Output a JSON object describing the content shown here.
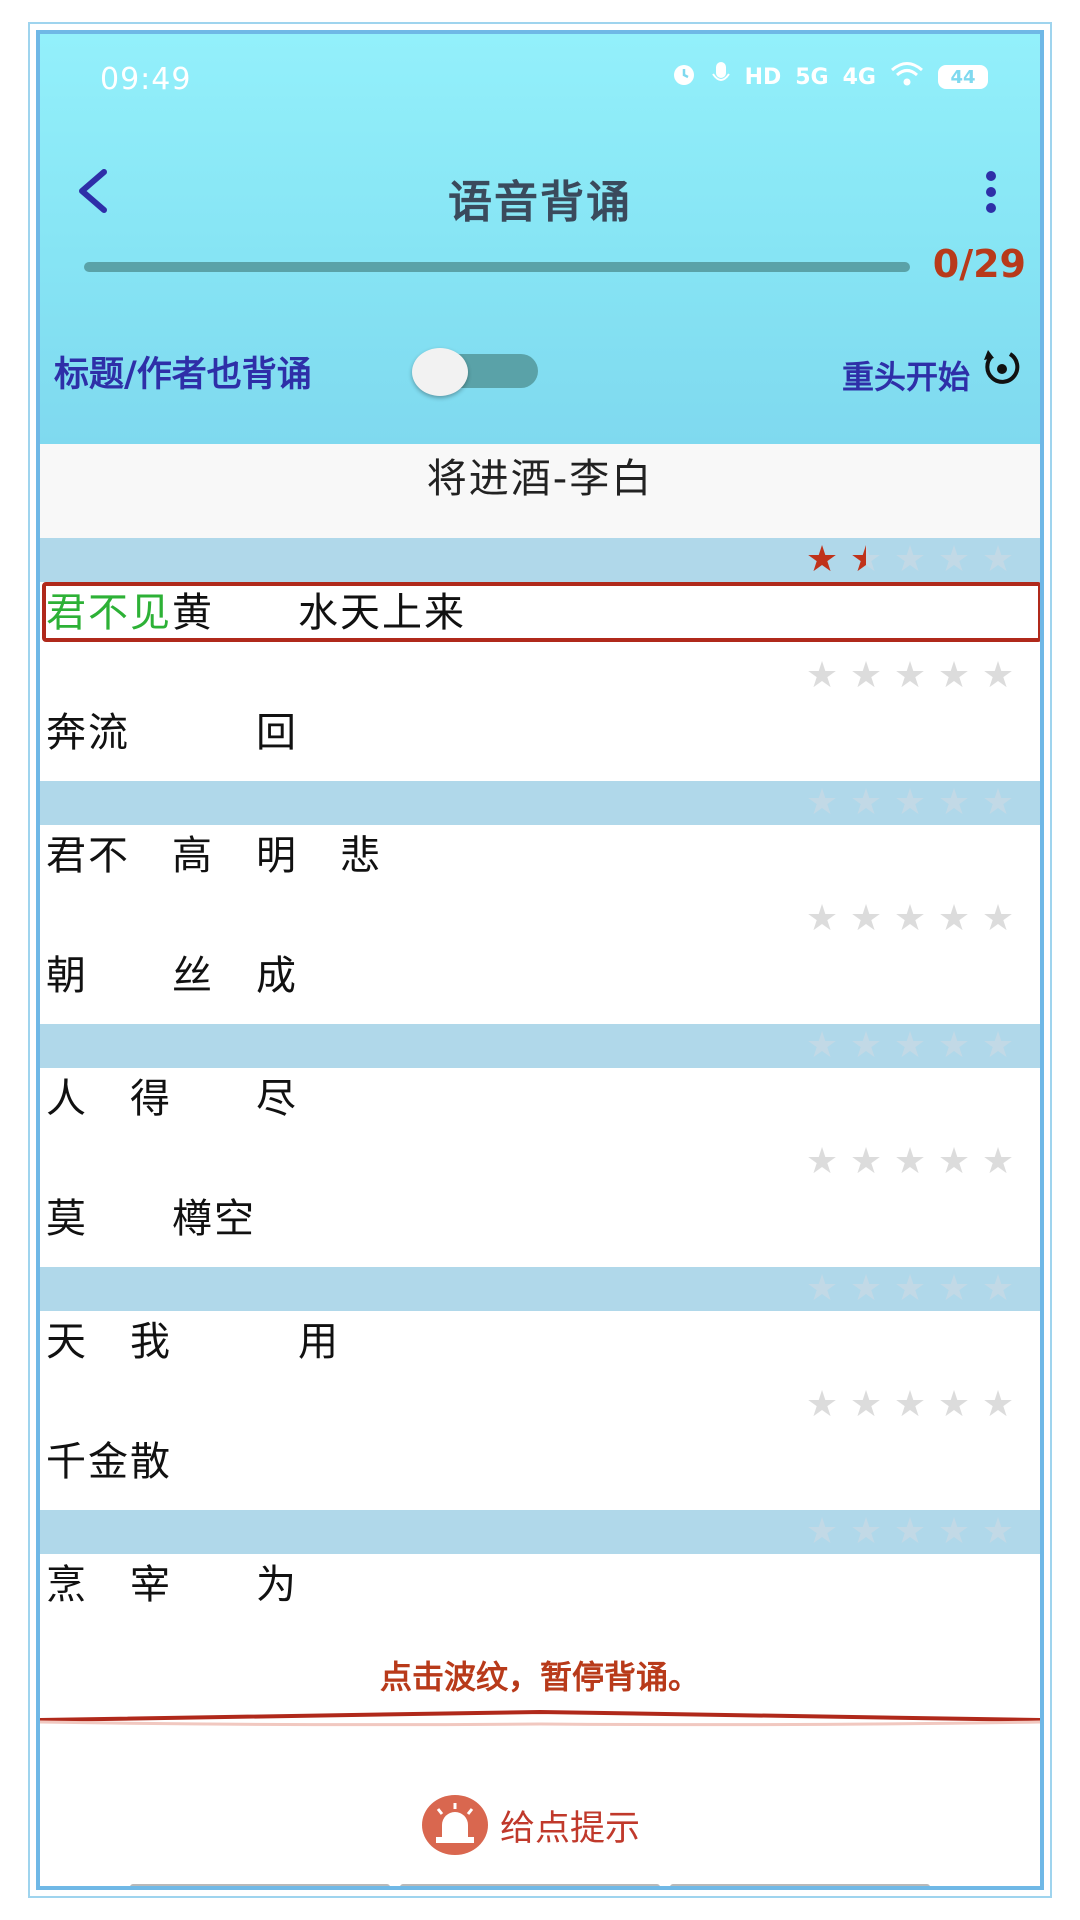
{
  "status_bar": {
    "time": "09:49",
    "hd_label": "HD",
    "net_5g": "5G",
    "net_4g": "4G",
    "battery": "44"
  },
  "header": {
    "title": "语音背诵"
  },
  "progress": {
    "text": "0/29",
    "fraction": 0.0
  },
  "controls": {
    "toggle_label": "标题/作者也背诵",
    "toggle_on": false,
    "restart_label": "重头开始"
  },
  "poem_title": "将进酒-李白",
  "couplets": [
    {
      "rating": 1.5,
      "line_a_pre": "君不见",
      "line_a": "黄　　水天上来",
      "line_b_rating": 0,
      "line_b": "奔流　　　回"
    },
    {
      "rating": 0,
      "line_a_pre": "",
      "line_a": "君不　高　明　悲",
      "line_b_rating": 0,
      "line_b": "朝　　丝　成"
    },
    {
      "rating": 0,
      "line_a_pre": "",
      "line_a": "人　得　　尽",
      "line_b_rating": 0,
      "line_b": "莫　　樽空"
    },
    {
      "rating": 0,
      "line_a_pre": "",
      "line_a": "天　我　　　用",
      "line_b_rating": 0,
      "line_b": "千金散"
    },
    {
      "rating": 0,
      "line_a_pre": "",
      "line_a": "烹　宰　　为",
      "line_b_rating": 0,
      "line_b": ""
    }
  ],
  "bottom": {
    "pause_hint": "点击波纹，暂停背诵。",
    "hint_button": "给点提示"
  },
  "colors": {
    "header_top": "#93f0fb",
    "accent_red": "#c0321a",
    "label_blue": "#2e2fa8",
    "reveal_green": "#2db136"
  }
}
